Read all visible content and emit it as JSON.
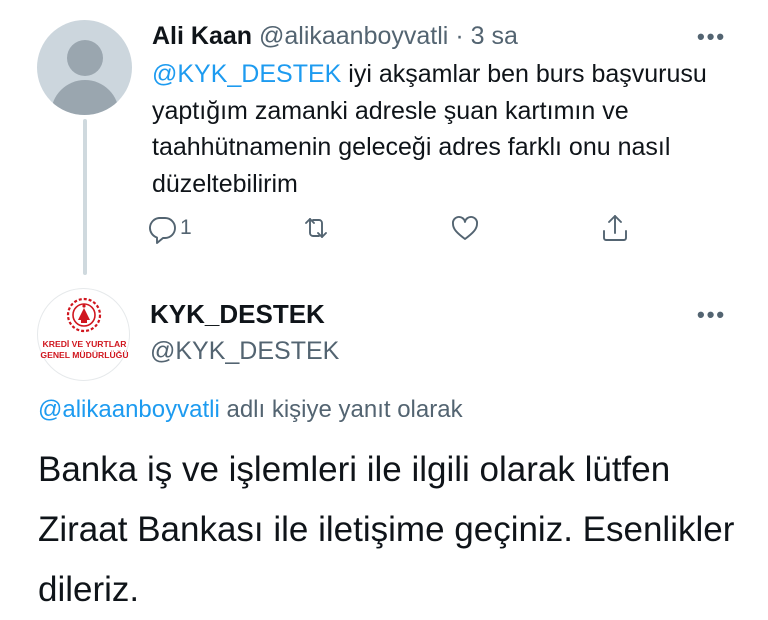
{
  "reply_tweet": {
    "display_name": "Ali Kaan",
    "handle": "@alikaanboyvatli",
    "separator": "·",
    "time": "3 sa",
    "more_label": "•••",
    "mention": "@KYK_DESTEK",
    "text": "iyi akşamlar ben burs başvurusu yaptığım zamanki adresle şuan kartımın ve taahhütnamenin geleceği  adres farklı onu nasıl düzeltebilirim",
    "reply_count": "1",
    "actions": {
      "reply_icon": "reply-bubble-icon",
      "retweet_icon": "retweet-icon",
      "like_icon": "heart-icon",
      "share_icon": "share-icon"
    }
  },
  "main_tweet": {
    "display_name": "KYK_DESTEK",
    "handle": "@KYK_DESTEK",
    "more_label": "•••",
    "avatar": {
      "logo_line1": "KREDİ VE YURTLAR",
      "logo_line2": "GENEL MÜDÜRLÜĞÜ",
      "brand_color": "#d0161e"
    },
    "replying_to_mention": "@alikaanboyvatli",
    "replying_to_suffix": "adlı kişiye yanıt olarak",
    "text": "Banka iş ve işlemleri ile ilgili olarak lütfen Ziraat Bankası ile iletişime geçiniz. Esenlikler dileriz."
  },
  "colors": {
    "link": "#1d9bf0",
    "muted": "#536471",
    "text": "#0f1419",
    "thread_line": "#cfd9de"
  }
}
